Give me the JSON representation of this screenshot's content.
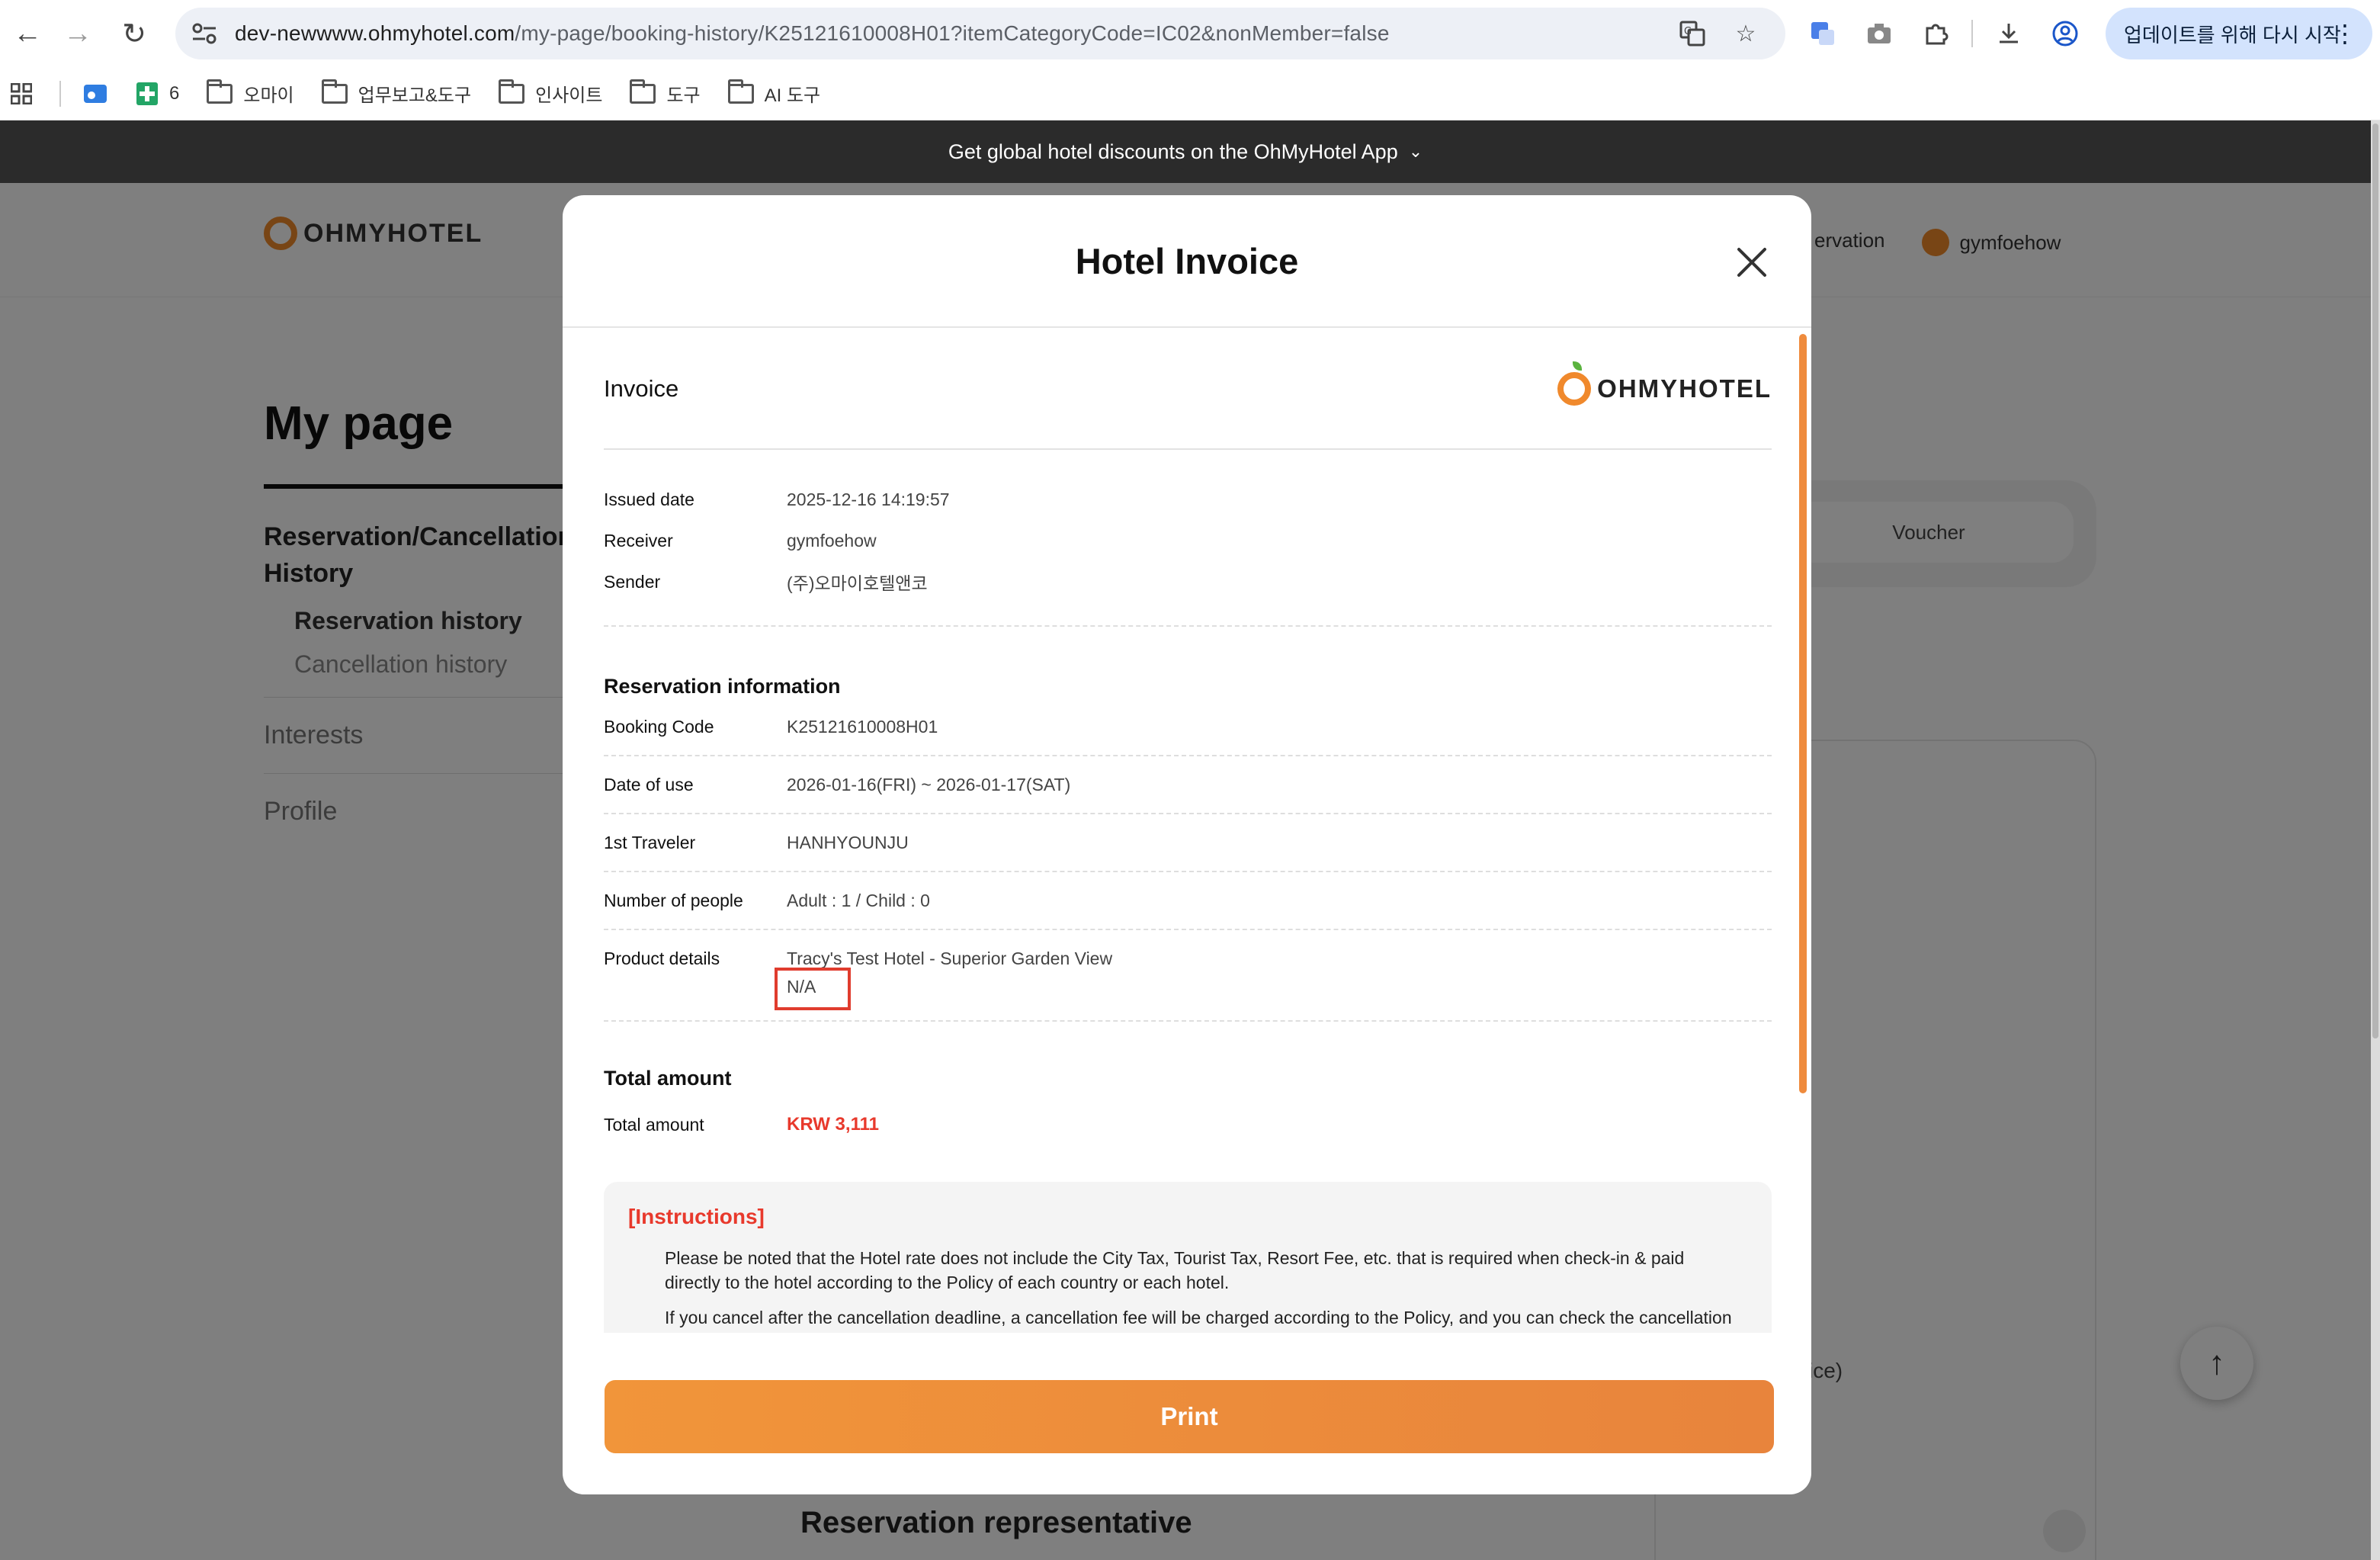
{
  "browser": {
    "url_host": "dev-newwww.ohmyhotel.com",
    "url_path": "/my-page/booking-history/K25121610008H01?itemCategoryCode=IC02&nonMember=false",
    "update_label": "업데이트를 위해 다시 시작"
  },
  "bookmarks": {
    "count_label": "6",
    "folders": [
      "오마이",
      "업무보고&도구",
      "인사이트",
      "도구",
      "AI 도구"
    ]
  },
  "promo": {
    "text": "Get global hotel discounts on the OhMyHotel App"
  },
  "site": {
    "brand": "OHMYHOTEL",
    "header_link": "ervation",
    "user": "gymfoehow"
  },
  "mypage": {
    "title": "My page",
    "group": "Reservation/Cancellation History",
    "sub_reservation": "Reservation history",
    "sub_cancellation": "Cancellation history",
    "interests": "Interests",
    "profile": "Profile",
    "voucher_tab": "Voucher",
    "partial_text": "ice)",
    "rep_title": "Reservation representative"
  },
  "modal": {
    "title": "Hotel Invoice",
    "invoice_label": "Invoice",
    "brand": "OHMYHOTEL",
    "meta": {
      "issued_label": "Issued date",
      "issued_value": "2025-12-16 14:19:57",
      "receiver_label": "Receiver",
      "receiver_value": "gymfoehow",
      "sender_label": "Sender",
      "sender_value": "(주)오마이호텔앤코"
    },
    "reservation": {
      "title": "Reservation information",
      "booking_label": "Booking Code",
      "booking_value": "K25121610008H01",
      "date_label": "Date of use",
      "date_value": "2026-01-16(FRI) ~ 2026-01-17(SAT)",
      "traveler_label": "1st Traveler",
      "traveler_value": "HANHYOUNJU",
      "people_label": "Number of people",
      "people_value": "Adult : 1 / Child : 0",
      "product_label": "Product details",
      "product_value": "Tracy's Test Hotel - Superior Garden View",
      "product_extra": "N/A"
    },
    "total": {
      "title": "Total amount",
      "label": "Total amount",
      "value": "KRW 3,111"
    },
    "instructions": {
      "title": "[Instructions]",
      "p1": "Please be noted that the Hotel rate does not include the City Tax, Tourist Tax, Resort Fee, etc. that is required when check-in & paid directly to the hotel according to the Policy of each country or each hotel.",
      "p2": "If you cancel after the cancellation deadline, a cancellation fee will be charged according to the Policy, and you can check the cancellation fee in My Page - Reservation Details - Cancellation Policy."
    },
    "print_label": "Print"
  },
  "colors": {
    "accent": "#f08a2b",
    "price": "#e8392c",
    "highlight": "#e03c2e"
  }
}
